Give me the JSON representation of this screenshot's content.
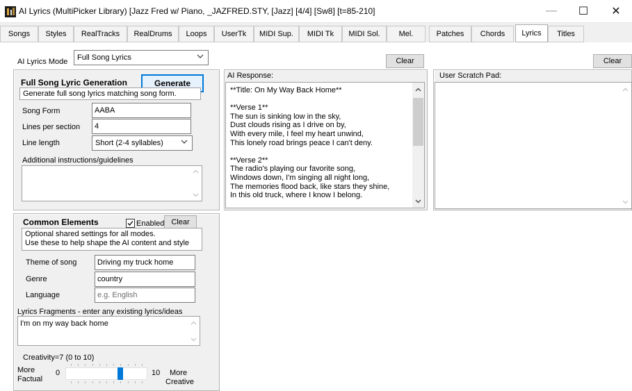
{
  "window": {
    "title": "AI Lyrics  (MultiPicker Library)  [Jazz Fred w/ Piano, _JAZFRED.STY,  [Jazz] [4/4] [Sw8] [t=85-210]",
    "minimize_glyph": "—",
    "maximize_glyph": "☐",
    "close_glyph": "✕"
  },
  "tabs": [
    "Songs",
    "Styles",
    "RealTracks",
    "RealDrums",
    "Loops",
    "UserTk",
    "MIDI Sup.",
    "MIDI Tk",
    "MIDI Sol.",
    "Mel.",
    "Patches",
    "Chords",
    "Lyrics",
    "Titles"
  ],
  "active_tab": "Lyrics",
  "mode": {
    "label": "AI Lyrics Mode",
    "value": "Full Song Lyrics"
  },
  "generation": {
    "heading": "Full Song Lyric Generation",
    "generate_label": "Generate",
    "description": "Generate full song lyrics matching song form.",
    "song_form_label": "Song Form",
    "song_form_value": "AABA",
    "lines_label": "Lines per section",
    "lines_value": "4",
    "line_length_label": "Line length",
    "line_length_value": "Short (2-4 syllables)",
    "instructions_label": "Additional instructions/guidelines",
    "instructions_value": ""
  },
  "common": {
    "heading": "Common Elements",
    "enabled_label": "Enabled",
    "enabled": true,
    "clear_label": "Clear",
    "description_line1": "Optional shared settings for all modes.",
    "description_line2": "Use these to help shape the AI content and style",
    "theme_label": "Theme of song",
    "theme_value": "Driving my truck home",
    "genre_label": "Genre",
    "genre_value": "country",
    "language_label": "Language",
    "language_placeholder": "e.g. English",
    "fragments_label": "Lyrics Fragments - enter any existing lyrics/ideas",
    "fragments_value": "I'm on my way back home",
    "creativity_label": "Creativity=7  (0 to 10)",
    "creativity_value": 7,
    "creativity_min": "0",
    "creativity_max": "10",
    "more_factual_1": "More",
    "more_factual_2": "Factual",
    "more_creative_1": "More",
    "more_creative_2": "Creative"
  },
  "ai_response": {
    "clear_label": "Clear",
    "label": "AI Response:",
    "lines": [
      "**Title: On My Way Back Home**",
      "",
      "**Verse 1**",
      "The sun is sinking low in the sky,",
      "Dust clouds rising as I drive on by,",
      "With every mile, I feel my heart unwind,",
      "This lonely road brings peace I can't deny.",
      "",
      "**Verse 2**",
      "The radio's playing our favorite song,",
      "Windows down, I'm singing all night long,",
      "The memories flood back, like stars they shine,",
      "In this old truck, where I know I belong."
    ]
  },
  "scratch": {
    "clear_label": "Clear",
    "label": "User Scratch Pad:",
    "value": ""
  }
}
